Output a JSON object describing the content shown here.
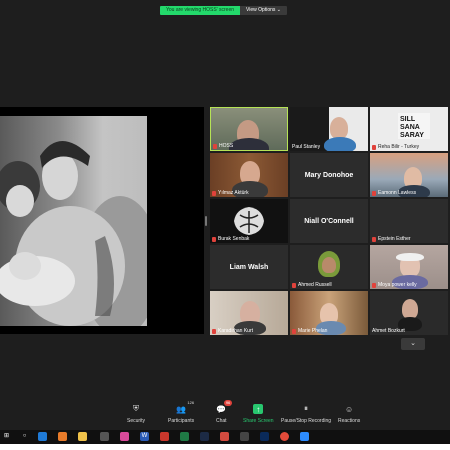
{
  "banner": {
    "message": "You are viewing HOSS' screen",
    "options_label": "View Options ⌄"
  },
  "participants": [
    {
      "label": "HOSS",
      "active": true,
      "video": true
    },
    {
      "label": "Paul Stanley",
      "video": true
    },
    {
      "label": "Reha Bilir - Turkey",
      "video": true
    },
    {
      "label": "Yılmaz Aktürk",
      "video": true
    },
    {
      "label": "Mary Donohoe",
      "video": false
    },
    {
      "label": "Eamonn Lawless",
      "video": true
    },
    {
      "label": "Burak Senbak",
      "video": true
    },
    {
      "label": "Niall O'Connell",
      "video": false
    },
    {
      "label": "Epstein Esther",
      "video": false
    },
    {
      "label": "Liam Walsh",
      "video": false
    },
    {
      "label": "Ahmed Russell",
      "video": true
    },
    {
      "label": "Moya power kelly",
      "video": true
    },
    {
      "label": "Karadirhan Kurt",
      "video": true
    },
    {
      "label": "Marie Phelan",
      "video": true
    },
    {
      "label": "Ahmet Bozkurt",
      "video": true
    }
  ],
  "pager": {
    "icon": "chevron-down-icon",
    "glyph": "⌄"
  },
  "toolbar": {
    "security": "Security",
    "participants": "Participants",
    "participants_count": "126",
    "chat": "Chat",
    "chat_badge": "96",
    "share_screen": "Share Screen",
    "recording": "Pause/Stop Recording",
    "reactions": "Reactions"
  },
  "taskbar_icons": [
    "windows-icon",
    "search-icon",
    "edge-icon",
    "store-icon",
    "explorer-icon",
    "app-icon",
    "app-icon",
    "word-icon",
    "app-icon",
    "excel-icon",
    "lr-icon",
    "app-icon",
    "app-icon",
    "ps-icon",
    "chrome-icon",
    "zoom-icon"
  ],
  "colors": {
    "active_border": "#b6e356",
    "share_green": "#28c76f",
    "banner_green": "#23d96b",
    "mic_red": "#e0423b"
  }
}
